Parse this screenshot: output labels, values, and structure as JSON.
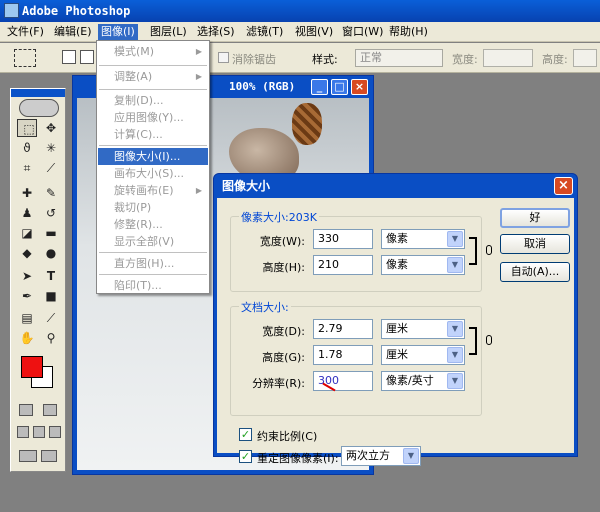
{
  "app": {
    "title": "Adobe Photoshop"
  },
  "menubar": {
    "items": [
      {
        "label": "文件(F)",
        "active": false
      },
      {
        "label": "编辑(E)",
        "active": false
      },
      {
        "label": "图像(I)",
        "active": true
      },
      {
        "label": "图层(L)",
        "active": false
      },
      {
        "label": "选择(S)",
        "active": false
      },
      {
        "label": "滤镜(T)",
        "active": false
      },
      {
        "label": "视图(V)",
        "active": false
      },
      {
        "label": "窗口(W)",
        "active": false
      },
      {
        "label": "帮助(H)",
        "active": false
      }
    ]
  },
  "options_bar": {
    "antialias_label": "消除锯齿",
    "style_label": "样式:",
    "style_value": "正常",
    "width_label": "宽度:",
    "height_label": "高度:"
  },
  "document": {
    "title": "100% (RGB)"
  },
  "image_menu": {
    "items": [
      {
        "label": "模式(M)",
        "enabled": false,
        "submenu": true
      },
      {
        "label": "调整(A)",
        "enabled": false,
        "submenu": true
      },
      {
        "label": "复制(D)...",
        "enabled": false
      },
      {
        "label": "应用图像(Y)...",
        "enabled": false
      },
      {
        "label": "计算(C)...",
        "enabled": false
      },
      {
        "label": "图像大小(I)...",
        "enabled": true,
        "highlighted": true
      },
      {
        "label": "画布大小(S)...",
        "enabled": false
      },
      {
        "label": "旋转画布(E)",
        "enabled": false,
        "submenu": true
      },
      {
        "label": "裁切(P)",
        "enabled": false
      },
      {
        "label": "修整(R)...",
        "enabled": false
      },
      {
        "label": "显示全部(V)",
        "enabled": false
      },
      {
        "label": "直方图(H)...",
        "enabled": false
      },
      {
        "label": "陷印(T)...",
        "enabled": false
      }
    ]
  },
  "dialog": {
    "title": "图像大小",
    "pixel_group": {
      "title": "像素大小:203K",
      "width_label": "宽度(W):",
      "width_value": "330",
      "width_unit": "像素",
      "height_label": "高度(H):",
      "height_value": "210",
      "height_unit": "像素"
    },
    "doc_group": {
      "title": "文档大小:",
      "width_label": "宽度(D):",
      "width_value": "2.79",
      "width_unit": "厘米",
      "height_label": "高度(G):",
      "height_value": "1.78",
      "height_unit": "厘米",
      "res_label": "分辨率(R):",
      "res_value": "300",
      "res_unit": "像素/英寸"
    },
    "constrain_label": "约束比例(C)",
    "constrain_checked": true,
    "resample_label": "重定图像像素(I):",
    "resample_checked": true,
    "resample_method": "两次立方",
    "buttons": {
      "ok": "好",
      "cancel": "取消",
      "auto": "自动(A)..."
    }
  },
  "colors": {
    "foreground": "#ee1111",
    "background": "#ffffff",
    "titlebar": "#0a4ec4",
    "menu_highlight": "#316ac5"
  },
  "icons": {
    "tools": [
      "marquee-icon",
      "move-icon",
      "lasso-icon",
      "magic-wand-icon",
      "crop-icon",
      "slice-icon",
      "healing-brush-icon",
      "brush-icon",
      "stamp-icon",
      "history-brush-icon",
      "eraser-icon",
      "gradient-icon",
      "blur-icon",
      "dodge-icon",
      "path-select-icon",
      "type-icon",
      "pen-icon",
      "shape-icon",
      "notes-icon",
      "eyedropper-icon",
      "hand-icon",
      "zoom-icon"
    ]
  }
}
